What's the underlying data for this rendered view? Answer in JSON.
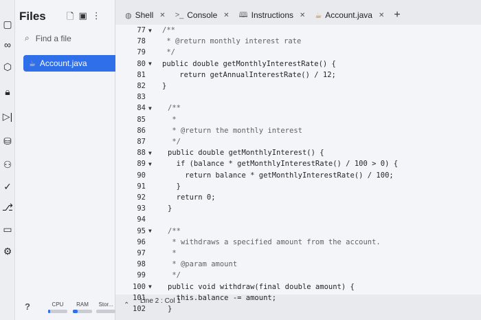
{
  "sidebar": {
    "title": "Files",
    "find_placeholder": "Find a file",
    "active_file": "Account.java"
  },
  "rail_icons": [
    "cube-icon",
    "lock-icon",
    "debugger-icon",
    "database-icon",
    "users-icon",
    "check-icon",
    "git-icon",
    "terminal-icon",
    "settings-icon"
  ],
  "tabs": [
    {
      "label": "Shell",
      "icon": "shell-icon"
    },
    {
      "label": "Console",
      "icon": "console-icon"
    },
    {
      "label": "Instructions",
      "icon": "book-icon"
    },
    {
      "label": "Account.java",
      "icon": "java-icon",
      "active": true
    }
  ],
  "status": {
    "cpu_label": "CPU",
    "ram_label": "RAM",
    "storage_label": "Stor...",
    "cursor": "Line 2 : Col 1"
  },
  "editor": {
    "lines": [
      {
        "n": "77",
        "fold": true,
        "text": "/**",
        "indent": 0,
        "comment": true
      },
      {
        "n": "78",
        "fold": false,
        "text": " * @return monthly interest rate",
        "indent": 0,
        "comment": true
      },
      {
        "n": "79",
        "fold": false,
        "text": " */",
        "indent": 0,
        "comment": true
      },
      {
        "n": "80",
        "fold": true,
        "text": "public double getMonthlyInterestRate() {",
        "indent": 0,
        "comment": false
      },
      {
        "n": "81",
        "fold": false,
        "text": "    return getAnnualInterestRate() / 12;",
        "indent": 0,
        "comment": false
      },
      {
        "n": "82",
        "fold": false,
        "text": "}",
        "indent": 0,
        "comment": false
      },
      {
        "n": "83",
        "fold": false,
        "text": "",
        "indent": 0,
        "comment": false
      },
      {
        "n": "84",
        "fold": true,
        "text": "/**",
        "indent": 1,
        "comment": true
      },
      {
        "n": "85",
        "fold": false,
        "text": " *",
        "indent": 1,
        "comment": true
      },
      {
        "n": "86",
        "fold": false,
        "text": " * @return the monthly interest",
        "indent": 1,
        "comment": true
      },
      {
        "n": "87",
        "fold": false,
        "text": " */",
        "indent": 1,
        "comment": true
      },
      {
        "n": "88",
        "fold": true,
        "text": "public double getMonthlyInterest() {",
        "indent": 1,
        "comment": false
      },
      {
        "n": "89",
        "fold": true,
        "text": "  if (balance * getMonthlyInterestRate() / 100 > 0) {",
        "indent": 1,
        "comment": false
      },
      {
        "n": "90",
        "fold": false,
        "text": "    return balance * getMonthlyInterestRate() / 100;",
        "indent": 1,
        "comment": false
      },
      {
        "n": "91",
        "fold": false,
        "text": "  }",
        "indent": 1,
        "comment": false
      },
      {
        "n": "92",
        "fold": false,
        "text": "  return 0;",
        "indent": 1,
        "comment": false
      },
      {
        "n": "93",
        "fold": false,
        "text": "}",
        "indent": 1,
        "comment": false
      },
      {
        "n": "94",
        "fold": false,
        "text": "",
        "indent": 1,
        "comment": false
      },
      {
        "n": "95",
        "fold": true,
        "text": "/**",
        "indent": 1,
        "comment": true
      },
      {
        "n": "96",
        "fold": false,
        "text": " * withdraws a specified amount from the account.",
        "indent": 1,
        "comment": true
      },
      {
        "n": "97",
        "fold": false,
        "text": " *",
        "indent": 1,
        "comment": true
      },
      {
        "n": "98",
        "fold": false,
        "text": " * @param amount",
        "indent": 1,
        "comment": true
      },
      {
        "n": "99",
        "fold": false,
        "text": " */",
        "indent": 1,
        "comment": true
      },
      {
        "n": "100",
        "fold": true,
        "text": "public void withdraw(final double amount) {",
        "indent": 1,
        "comment": false
      },
      {
        "n": "101",
        "fold": false,
        "text": "  this.balance -= amount;",
        "indent": 1,
        "comment": false
      },
      {
        "n": "102",
        "fold": false,
        "text": "}",
        "indent": 1,
        "comment": false
      }
    ]
  }
}
